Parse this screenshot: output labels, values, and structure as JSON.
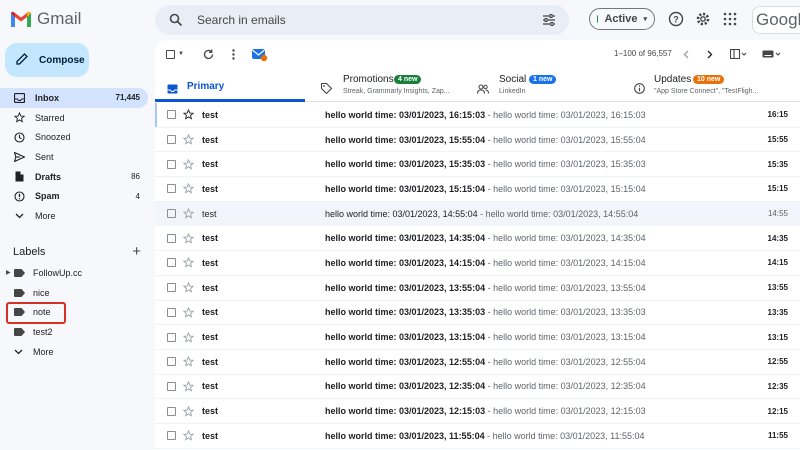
{
  "header": {
    "app_name": "Gmail",
    "search_placeholder": "Search in emails",
    "status": "Active",
    "brand_word": "Google"
  },
  "nav": {
    "compose_label": "Compose",
    "items": [
      {
        "label": "Inbox",
        "count": "71,445",
        "icon": "inbox-icon"
      },
      {
        "label": "Starred",
        "count": "",
        "icon": "star-icon"
      },
      {
        "label": "Snoozed",
        "count": "",
        "icon": "clock-icon"
      },
      {
        "label": "Sent",
        "count": "",
        "icon": "send-icon"
      },
      {
        "label": "Drafts",
        "count": "86",
        "icon": "draft-icon"
      },
      {
        "label": "Spam",
        "count": "4",
        "icon": "spam-icon"
      },
      {
        "label": "More",
        "count": "",
        "icon": "chevron-down-icon"
      }
    ]
  },
  "labels": {
    "title": "Labels",
    "items": [
      {
        "label": "FollowUp.cc"
      },
      {
        "label": "nice"
      },
      {
        "label": "note"
      },
      {
        "label": "test2"
      },
      {
        "label": "More"
      }
    ]
  },
  "toolbar": {
    "pager": "1–100 of 96,557"
  },
  "tabs": {
    "primary": {
      "label": "Primary"
    },
    "promotions": {
      "label": "Promotions",
      "badge": "4 new",
      "sub": "Streak, Grammarly Insights, Zap..."
    },
    "social": {
      "label": "Social",
      "badge": "1 new",
      "sub": "LinkedIn"
    },
    "updates": {
      "label": "Updates",
      "badge": "10 new",
      "sub": "\"App Store Connect\", \"TestFligh..."
    }
  },
  "colors": {
    "accent": "#0b57d0",
    "compose_bg": "#c2e7ff",
    "inbox_active": "#d3e3fd",
    "promotions_badge": "#188038",
    "social_badge": "#1a73e8",
    "updates_badge": "#e8710a",
    "highlight_box": "#d93025"
  },
  "emails": [
    {
      "sender": "test",
      "subject": "hello world time: 03/01/2023, 16:15:03",
      "snippet": " - hello world time: 03/01/2023, 16:15:03",
      "time": "16:15",
      "read": false
    },
    {
      "sender": "test",
      "subject": "hello world time: 03/01/2023, 15:55:04",
      "snippet": " - hello world time: 03/01/2023, 15:55:04",
      "time": "15:55",
      "read": false
    },
    {
      "sender": "test",
      "subject": "hello world time: 03/01/2023, 15:35:03",
      "snippet": " - hello world time: 03/01/2023, 15:35:03",
      "time": "15:35",
      "read": false
    },
    {
      "sender": "test",
      "subject": "hello world time: 03/01/2023, 15:15:04",
      "snippet": " - hello world time: 03/01/2023, 15:15:04",
      "time": "15:15",
      "read": false
    },
    {
      "sender": "test",
      "subject": "hello world time: 03/01/2023, 14:55:04",
      "snippet": " - hello world time: 03/01/2023, 14:55:04",
      "time": "14:55",
      "read": true
    },
    {
      "sender": "test",
      "subject": "hello world time: 03/01/2023, 14:35:04",
      "snippet": " - hello world time: 03/01/2023, 14:35:04",
      "time": "14:35",
      "read": false
    },
    {
      "sender": "test",
      "subject": "hello world time: 03/01/2023, 14:15:04",
      "snippet": " - hello world time: 03/01/2023, 14:15:04",
      "time": "14:15",
      "read": false
    },
    {
      "sender": "test",
      "subject": "hello world time: 03/01/2023, 13:55:04",
      "snippet": " - hello world time: 03/01/2023, 13:55:04",
      "time": "13:55",
      "read": false
    },
    {
      "sender": "test",
      "subject": "hello world time: 03/01/2023, 13:35:03",
      "snippet": " - hello world time: 03/01/2023, 13:35:03",
      "time": "13:35",
      "read": false
    },
    {
      "sender": "test",
      "subject": "hello world time: 03/01/2023, 13:15:04",
      "snippet": " - hello world time: 03/01/2023, 13:15:04",
      "time": "13:15",
      "read": false
    },
    {
      "sender": "test",
      "subject": "hello world time: 03/01/2023, 12:55:04",
      "snippet": " - hello world time: 03/01/2023, 12:55:04",
      "time": "12:55",
      "read": false
    },
    {
      "sender": "test",
      "subject": "hello world time: 03/01/2023, 12:35:04",
      "snippet": " - hello world time: 03/01/2023, 12:35:04",
      "time": "12:35",
      "read": false
    },
    {
      "sender": "test",
      "subject": "hello world time: 03/01/2023, 12:15:03",
      "snippet": " - hello world time: 03/01/2023, 12:15:03",
      "time": "12:15",
      "read": false
    },
    {
      "sender": "test",
      "subject": "hello world time: 03/01/2023, 11:55:04",
      "snippet": " - hello world time: 03/01/2023, 11:55:04",
      "time": "11:55",
      "read": false
    }
  ]
}
